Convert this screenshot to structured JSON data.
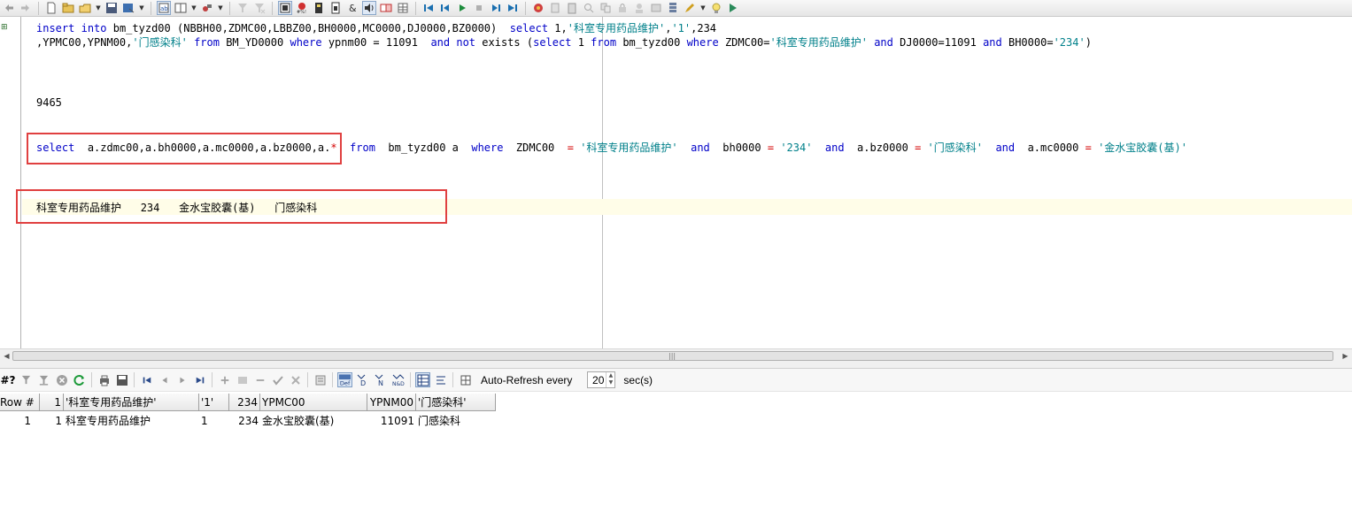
{
  "toolbar": {
    "icons": [
      "undo-icon",
      "redo-icon",
      "new-file-icon",
      "open-icon",
      "open-dropdown",
      "save-icon",
      "save-as-icon",
      "save-dropdown",
      "format-icon",
      "layout-icon",
      "layout-dropdown",
      "tools-icon",
      "tools-dropdown",
      "filter-icon",
      "clear-filter-icon",
      "explain-icon",
      "sql-icon",
      "export-icon",
      "import-icon",
      "ampersand-icon",
      "speaker-icon",
      "compare-icon",
      "grid-icon",
      "first-icon",
      "prev-icon",
      "play-icon",
      "stop-icon",
      "next-icon",
      "last-icon",
      "debug-icon",
      "bookmark-icon",
      "clipboard-icon",
      "find-icon",
      "replace-icon",
      "lock-icon",
      "user-icon",
      "stack-icon",
      "pencil-icon",
      "pencil-dropdown",
      "bulb-icon",
      "arrow-icon"
    ]
  },
  "editor": {
    "line1": {
      "kw_insert": "insert",
      "kw_into": "into",
      "table": "bm_tyzd00",
      "paren_open": "(",
      "cols": "NBBH00,ZDMC00,LBBZ00,BH0000,MC0000,DJ0000,BZ0000",
      "paren_close": ")",
      "kw_select": "select",
      "vals_a": "1,",
      "str1": "'科室专用药品维护'",
      "comma1": ",",
      "str2": "'1'",
      "vals_b": ",234"
    },
    "line2": {
      "cols_a": ",YPMC00,YPNM00,",
      "str3": "'门感染科'",
      "kw_from": "from",
      "table2": "BM_YD0000",
      "kw_where": "where",
      "cond1": "ypnm00 = 11091",
      "kw_and": "and",
      "kw_not": "not",
      "kw_exists": "exists",
      "paren_open2": "(",
      "kw_select2": "select",
      "sub_1": "1",
      "kw_from2": "from",
      "sub_table": "bm_tyzd00",
      "kw_where2": "where",
      "sub_col": "ZDMC00=",
      "str4": "'科室专用药品维护'",
      "kw_and2": "and",
      "sub_dj": "DJ0000=11091",
      "kw_and3": "and",
      "sub_bh": "BH0000=",
      "str5": "'234'",
      "paren_close2": ")"
    },
    "line3": {
      "number": "9465"
    },
    "line4": {
      "kw_select": "select",
      "cols": "a.zdmc00,a.bh0000,a.mc0000,a.bz0000,a.",
      "star": "*",
      "kw_from": "from",
      "table": "bm_tyzd00 a",
      "kw_where": "where",
      "col1": "ZDMC00",
      "eq1": "=",
      "str1": "'科室专用药品维护'",
      "kw_and1": "and",
      "col2": "bh0000",
      "eq2": "=",
      "str2": "'234'",
      "kw_and2": "and",
      "col3": "a.bz0000",
      "eq3": "=",
      "str3": "'门感染科'",
      "kw_and3": "and",
      "col4": "a.mc0000",
      "eq4": "=",
      "str4": "'金水宝胶囊(基)'"
    },
    "line5": {
      "v1": "科室专用药品维护",
      "v2": "234",
      "v3": "金水宝胶囊(基)",
      "v4": "门感染科"
    }
  },
  "results_toolbar": {
    "hash_label": "#?",
    "auto_refresh_label": "Auto-Refresh every",
    "refresh_value": "20",
    "sec_label": "sec(s)",
    "def_label": "Def"
  },
  "grid": {
    "headers": [
      "Row #",
      "1",
      "'科室专用药品维护'",
      "'1'",
      "234",
      "YPMC00",
      "YPNM00",
      "'门感染科'"
    ],
    "rows": [
      [
        "1",
        "1",
        "科室专用药品维护",
        "1",
        "234",
        "金水宝胶囊(基)",
        "11091",
        "门感染科"
      ]
    ]
  }
}
